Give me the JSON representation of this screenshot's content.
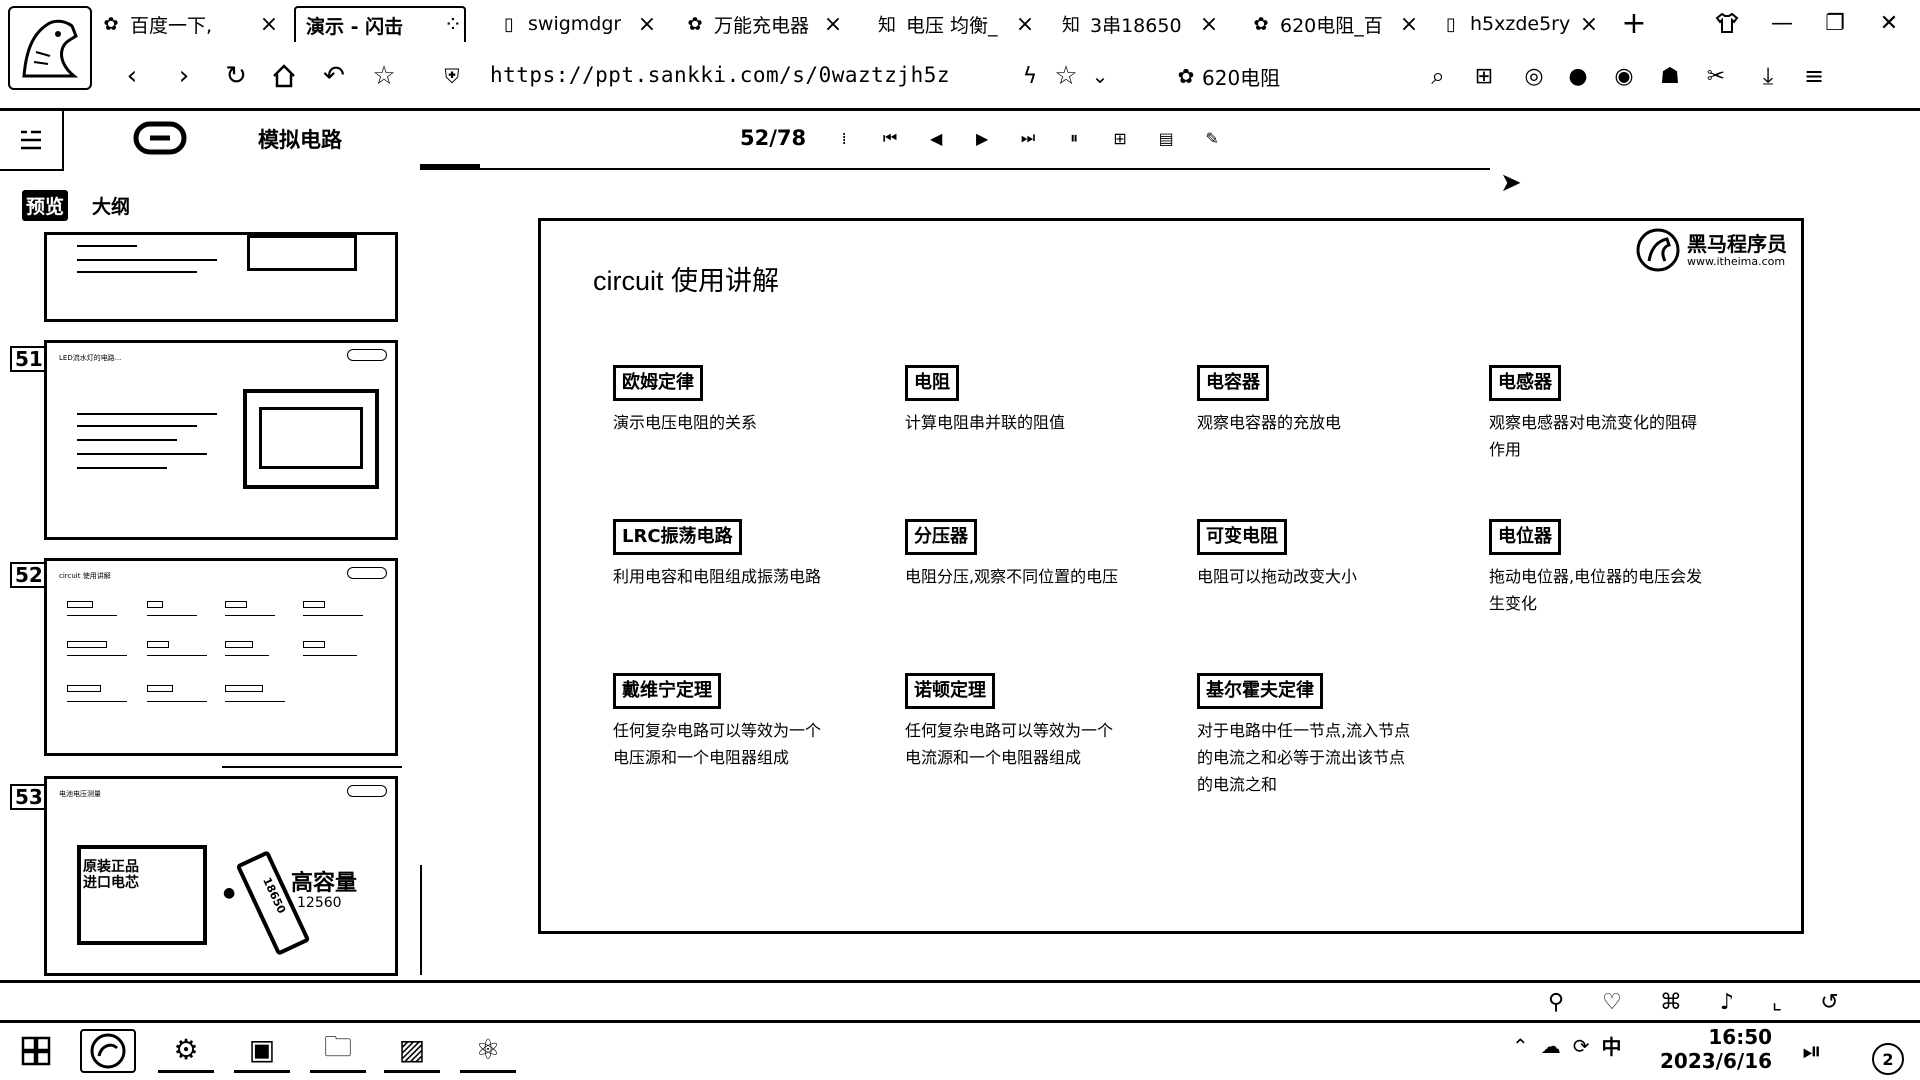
{
  "browser": {
    "tabs": [
      {
        "label": "百度一下,",
        "icon": "paw-icon",
        "active": false
      },
      {
        "label": "演示 - 闪击",
        "icon": "",
        "active": true
      },
      {
        "label": "swigmdgr",
        "icon": "page-icon",
        "active": false
      },
      {
        "label": "万能充电器",
        "icon": "paw-icon",
        "active": false
      },
      {
        "label": "电压 均衡_",
        "icon": "zhihu-icon",
        "active": false
      },
      {
        "label": "3串18650",
        "icon": "zhihu-icon",
        "active": false
      },
      {
        "label": "620电阻_百",
        "icon": "paw-icon",
        "active": false
      },
      {
        "label": "h5xzde5ry",
        "icon": "page-icon",
        "active": false
      }
    ],
    "url": "https://ppt.sankki.com/s/0waztzjh5z",
    "search_text": "620电阻"
  },
  "viewer": {
    "doc_title": "模拟电路",
    "page_indicator": "52/78"
  },
  "sidebar": {
    "tabs": [
      "预览",
      "大纲"
    ],
    "thumbnails": [
      {
        "number": ""
      },
      {
        "number": "51",
        "title": "LED流水灯的电路..."
      },
      {
        "number": "52",
        "title": "circuit 使用讲解"
      },
      {
        "number": "53",
        "title": "电池电压测量",
        "text_big": "高容量",
        "text_small": "12560",
        "text_label": "原装正品 进口电芯",
        "battery_label": "18650"
      }
    ]
  },
  "slide": {
    "title": "circuit 使用讲解",
    "logo_name": "黑马程序员",
    "logo_url": "www.itheima.com",
    "items": [
      {
        "badge": "欧姆定律",
        "desc": "演示电压电阻的关系"
      },
      {
        "badge": "电阻",
        "desc": "计算电阻串并联的阻值"
      },
      {
        "badge": "电容器",
        "desc": "观察电容器的充放电"
      },
      {
        "badge": "电感器",
        "desc": "观察电感器对电流变化的阻碍作用"
      },
      {
        "badge": "LRC振荡电路",
        "desc": "利用电容和电阻组成振荡电路"
      },
      {
        "badge": "分压器",
        "desc": "电阻分压,观察不同位置的电压"
      },
      {
        "badge": "可变电阻",
        "desc": "电阻可以拖动改变大小"
      },
      {
        "badge": "电位器",
        "desc": "拖动电位器,电位器的电压会发生变化"
      },
      {
        "badge": "戴维宁定理",
        "desc": "任何复杂电路可以等效为一个电压源和一个电阻器组成"
      },
      {
        "badge": "诺顿定理",
        "desc": "任何复杂电路可以等效为一个电流源和一个电阻器组成"
      },
      {
        "badge": "基尔霍夫定律",
        "desc": "对于电路中任一节点,流入节点的电流之和必等于流出该节点的电流之和"
      }
    ]
  },
  "taskbar": {
    "time": "16:50",
    "date": "2023/6/16",
    "ime": "中",
    "notifications": "2"
  }
}
